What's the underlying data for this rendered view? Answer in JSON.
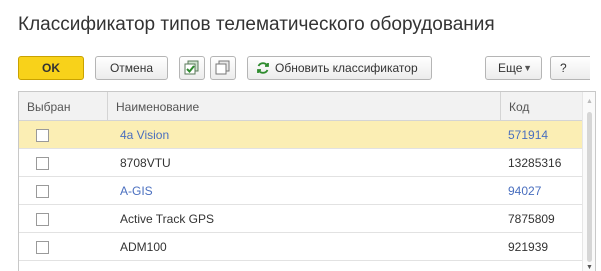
{
  "window": {
    "title": "Классификатор типов телематического оборудования"
  },
  "toolbar": {
    "ok_label": "OK",
    "cancel_label": "Отмена",
    "update_label": "Обновить классификатор",
    "more_label": "Еще",
    "help_label": "?"
  },
  "grid": {
    "columns": [
      "Выбран",
      "Наименование",
      "Код"
    ],
    "rows": [
      {
        "checked": false,
        "name": "4a Vision",
        "code": "571914",
        "selected": true,
        "link": true
      },
      {
        "checked": false,
        "name": "8708VTU",
        "code": "13285316",
        "selected": false,
        "link": false
      },
      {
        "checked": false,
        "name": "A-GIS",
        "code": "94027",
        "selected": false,
        "link": true
      },
      {
        "checked": false,
        "name": "Active Track GPS",
        "code": "7875809",
        "selected": false,
        "link": false
      },
      {
        "checked": false,
        "name": "ADM100",
        "code": "921939",
        "selected": false,
        "link": false
      }
    ]
  },
  "colors": {
    "ok_button": "#f8d21a",
    "selected_row": "#fbeeb4",
    "link_text": "#4a6fbf"
  }
}
